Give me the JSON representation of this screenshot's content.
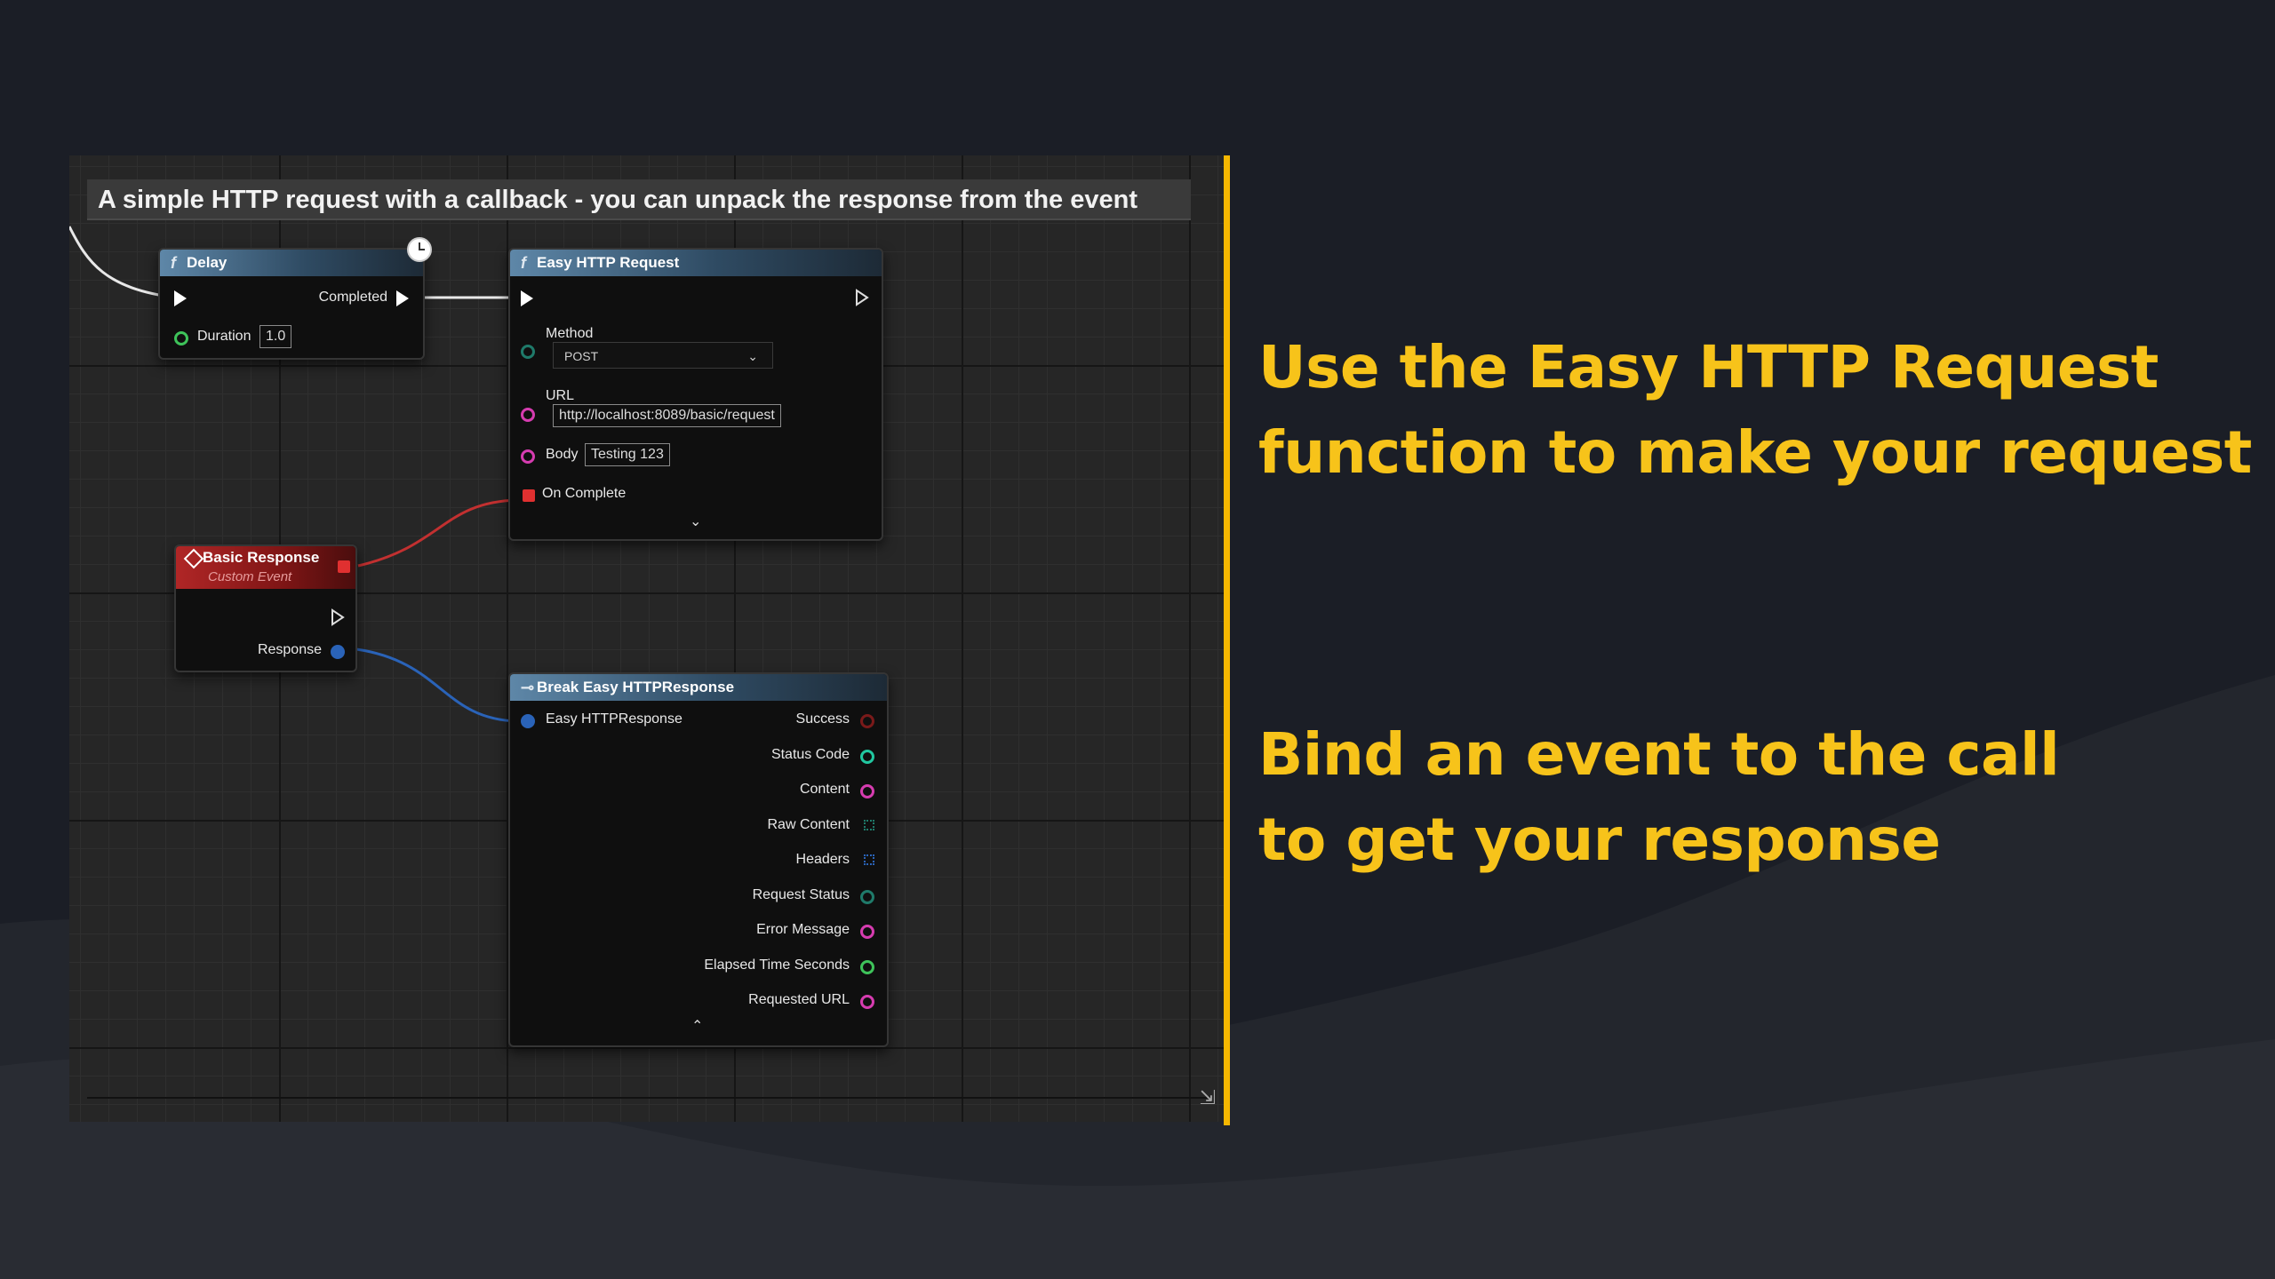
{
  "comment": "A simple HTTP request with a callback - you can unpack the response from the event",
  "captions": {
    "top": [
      "Use the Easy HTTP Request",
      "function to make your request"
    ],
    "bottom": [
      "Bind an event to the call",
      "to get your response"
    ]
  },
  "delay_node": {
    "title": "Delay",
    "completed_label": "Completed",
    "duration_label": "Duration",
    "duration_value": "1.0"
  },
  "request_node": {
    "title": "Easy HTTP Request",
    "method_label": "Method",
    "method_value": "POST",
    "url_label": "URL",
    "url_value": "http://localhost:8089/basic/request",
    "body_label": "Body",
    "body_value": "Testing 123",
    "on_complete_label": "On Complete"
  },
  "event_node": {
    "title": "Basic Response",
    "subtitle": "Custom Event",
    "response_label": "Response"
  },
  "break_node": {
    "title": "Break Easy HTTPResponse",
    "input_label": "Easy HTTPResponse",
    "outputs": [
      "Success",
      "Status Code",
      "Content",
      "Raw Content",
      "Headers",
      "Request Status",
      "Error Message",
      "Elapsed Time Seconds",
      "Requested URL"
    ]
  },
  "colors": {
    "accent": "#f6b700",
    "caption": "#f7c31a",
    "event_red": "#b02626",
    "function_blue": "#5e87a8"
  }
}
